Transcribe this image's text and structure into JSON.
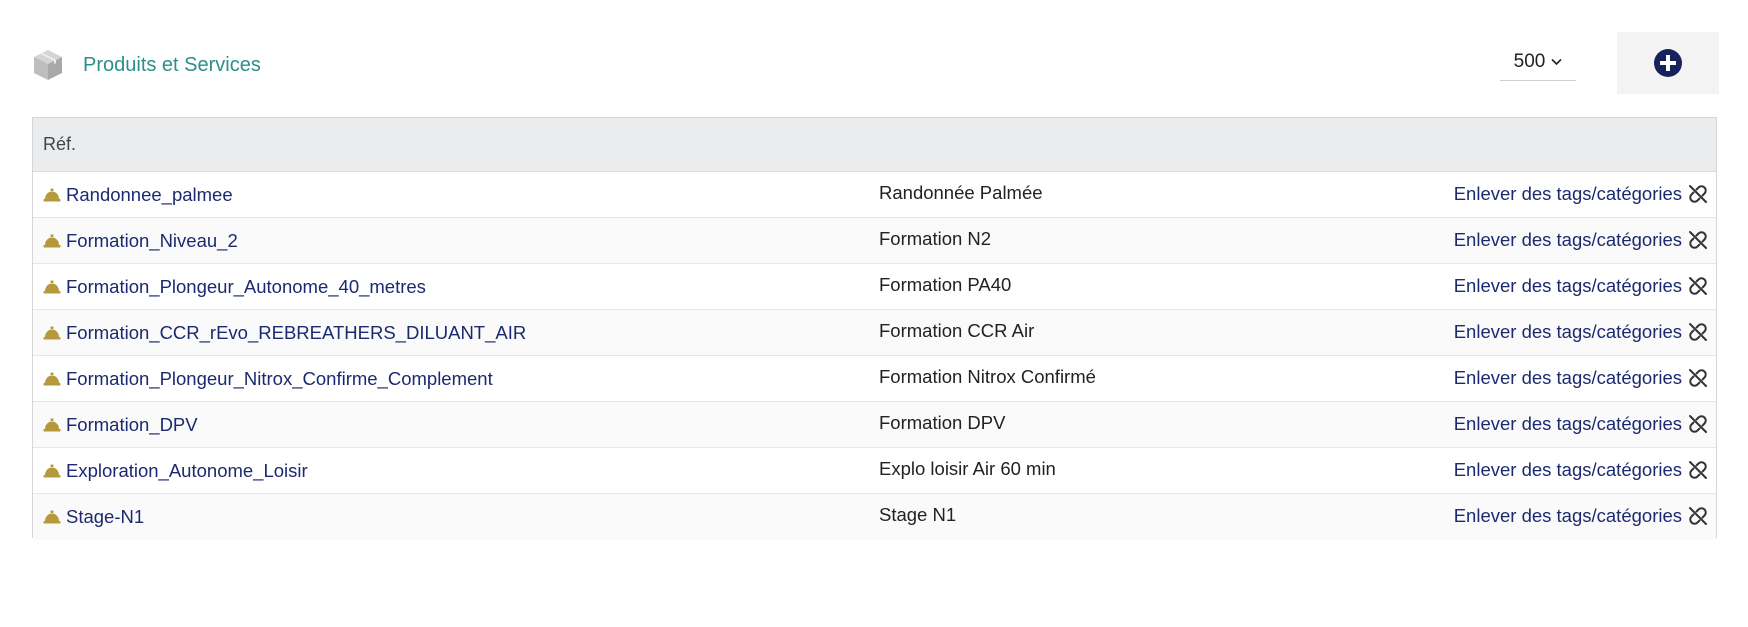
{
  "header": {
    "title": "Produits et Services",
    "limit_value": "500",
    "icons": {
      "section": "box-icon",
      "limit": "chevron-down-icon",
      "add": "plus-circle-icon"
    },
    "colors": {
      "title": "#2b8f8c",
      "add_button": "#17215e",
      "link": "#1b2a70",
      "bell": "#b59a3b"
    }
  },
  "table": {
    "column_header": "Réf.",
    "rows": [
      {
        "ref": "Randonnee_palmee",
        "label": "Randonnée Palmée",
        "action": "Enlever des tags/catégories",
        "icon": "service-bell-icon",
        "action_icon": "unlink-icon"
      },
      {
        "ref": "Formation_Niveau_2",
        "label": "Formation N2",
        "action": "Enlever des tags/catégories",
        "icon": "service-bell-icon",
        "action_icon": "unlink-icon"
      },
      {
        "ref": "Formation_Plongeur_Autonome_40_metres",
        "label": "Formation PA40",
        "action": "Enlever des tags/catégories",
        "icon": "service-bell-icon",
        "action_icon": "unlink-icon"
      },
      {
        "ref": "Formation_CCR_rEvo_REBREATHERS_DILUANT_AIR",
        "label": "Formation CCR Air",
        "action": "Enlever des tags/catégories",
        "icon": "service-bell-icon",
        "action_icon": "unlink-icon"
      },
      {
        "ref": "Formation_Plongeur_Nitrox_Confirme_Complement",
        "label": "Formation Nitrox Confirmé",
        "action": "Enlever des tags/catégories",
        "icon": "service-bell-icon",
        "action_icon": "unlink-icon"
      },
      {
        "ref": "Formation_DPV",
        "label": "Formation DPV",
        "action": "Enlever des tags/catégories",
        "icon": "service-bell-icon",
        "action_icon": "unlink-icon"
      },
      {
        "ref": "Exploration_Autonome_Loisir",
        "label": "Explo loisir Air 60 min",
        "action": "Enlever des tags/catégories",
        "icon": "service-bell-icon",
        "action_icon": "unlink-icon"
      },
      {
        "ref": "Stage-N1",
        "label": "Stage N1",
        "action": "Enlever des tags/catégories",
        "icon": "service-bell-icon",
        "action_icon": "unlink-icon"
      }
    ]
  }
}
